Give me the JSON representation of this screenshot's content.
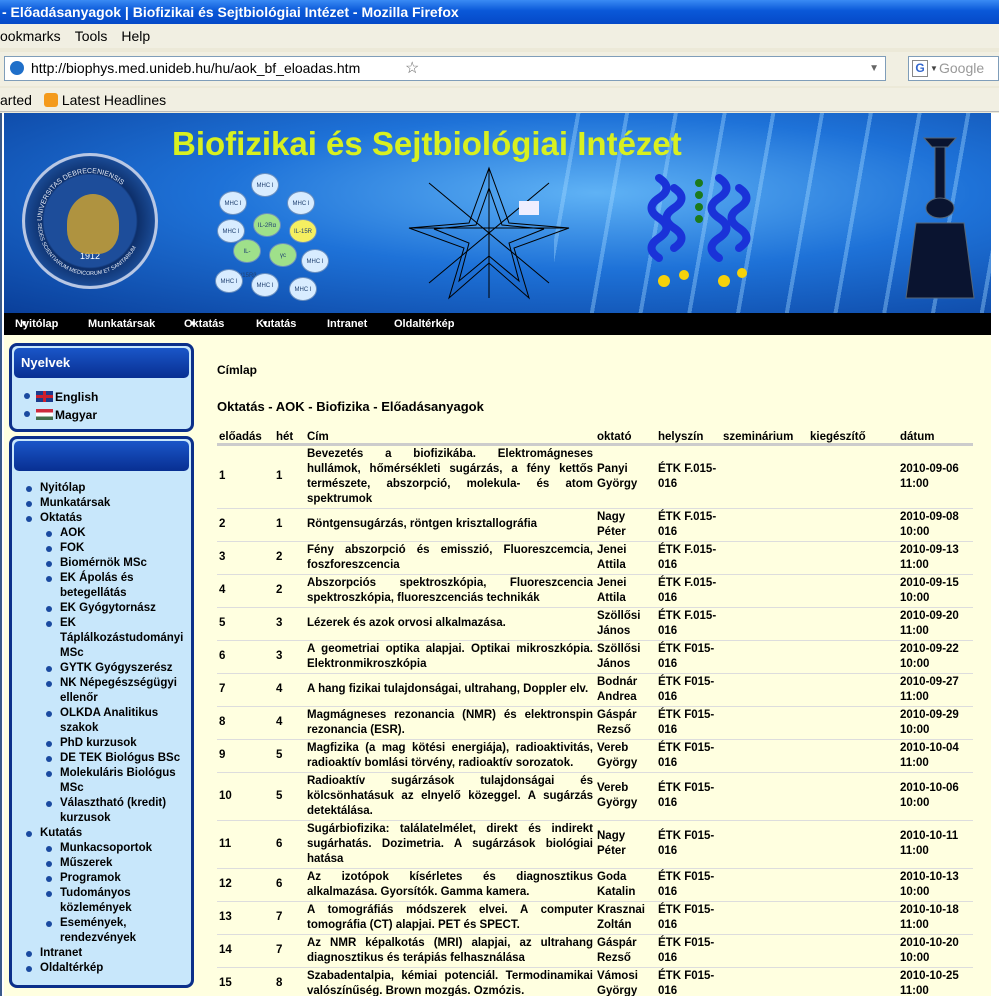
{
  "window": {
    "title": "- Előadásanyagok | Biofizikai és Sejtbiológiai Intézet - Mozilla Firefox"
  },
  "menu": [
    "ookmarks",
    "Tools",
    "Help"
  ],
  "nav": {
    "url": "http://biophys.med.unideb.hu/hu/aok_bf_eloadas.htm",
    "search_placeholder": "Google",
    "search_engine": "G"
  },
  "bookmarks": {
    "first": "arted",
    "feed": "Latest Headlines"
  },
  "banner": {
    "title": "Biofizikai és Sejtbiológiai Intézet",
    "seal_text_top": "UNIVERSITAS DEBRECENIENSIS",
    "seal_text_bottom": "SEDES SCIENTIARUM MEDICORUM ET SANITARIUM",
    "seal_year": "1912",
    "cells": [
      "MHC I",
      "MHC I",
      "MHC I",
      "MHC I",
      "IL-2Rα",
      "IL-15R",
      "MHC I",
      "IL-2/15Rβ",
      "γc",
      "MHC I",
      "MHC I",
      "MHC I"
    ]
  },
  "mainnav": [
    {
      "label": "Nyitólap",
      "caret": true
    },
    {
      "label": "Munkatársak",
      "caret": false
    },
    {
      "label": "Oktatás",
      "caret": true
    },
    {
      "label": "Kutatás",
      "caret": true
    },
    {
      "label": "Intranet",
      "caret": false
    },
    {
      "label": "Oldaltérkép",
      "caret": false
    }
  ],
  "sidebar": {
    "lang_title": "Nyelvek",
    "langs": [
      "English",
      "Magyar"
    ],
    "tree": [
      {
        "l": 1,
        "t": "Nyitólap"
      },
      {
        "l": 1,
        "t": "Munkatársak"
      },
      {
        "l": 1,
        "t": "Oktatás"
      },
      {
        "l": 2,
        "t": "AOK"
      },
      {
        "l": 2,
        "t": "FOK"
      },
      {
        "l": 2,
        "t": "Biomérnök MSc"
      },
      {
        "l": 2,
        "t": "EK Ápolás és betegellátás"
      },
      {
        "l": 2,
        "t": "EK Gyógytornász"
      },
      {
        "l": 2,
        "t": "EK Táplálkozástudományi MSc"
      },
      {
        "l": 2,
        "t": "GYTK Gyógyszerész"
      },
      {
        "l": 2,
        "t": "NK Népegészségügyi ellenőr"
      },
      {
        "l": 2,
        "t": "OLKDA Analitikus szakok"
      },
      {
        "l": 2,
        "t": "PhD kurzusok"
      },
      {
        "l": 2,
        "t": "DE TEK Biológus BSc"
      },
      {
        "l": 2,
        "t": "Molekuláris Biológus MSc"
      },
      {
        "l": 2,
        "t": "Választható (kredit) kurzusok"
      },
      {
        "l": 1,
        "t": "Kutatás"
      },
      {
        "l": 2,
        "t": "Munkacsoportok"
      },
      {
        "l": 2,
        "t": "Műszerek"
      },
      {
        "l": 2,
        "t": "Programok"
      },
      {
        "l": 2,
        "t": "Tudományos közlemények"
      },
      {
        "l": 2,
        "t": "Események, rendezvények"
      },
      {
        "l": 1,
        "t": "Intranet"
      },
      {
        "l": 1,
        "t": "Oldaltérkép"
      }
    ]
  },
  "main": {
    "breadcrumb": "Címlap",
    "title": "Oktatás - AOK - Biofizika - Előadásanyagok",
    "headers": [
      "előadás",
      "hét",
      "Cím",
      "oktató",
      "helyszín",
      "szeminárium",
      "kiegészítő",
      "dátum"
    ],
    "rows": [
      [
        "1",
        "1",
        "Bevezetés a biofizikába. Elektromágneses hullámok, hőmérsékleti sugárzás, a fény kettős természete, abszorpció, molekula- és atom spektrumok",
        "Panyi György",
        "ÉTK F.015-016",
        "",
        "",
        "2010-09-06 11:00"
      ],
      [
        "2",
        "1",
        "Röntgensugárzás, röntgen krisztallográfia",
        "Nagy Péter",
        "ÉTK F.015-016",
        "",
        "",
        "2010-09-08 10:00"
      ],
      [
        "3",
        "2",
        "Fény abszorpció és emisszió, Fluoreszcemcia, foszforeszcencia",
        "Jenei Attila",
        "ÉTK F.015-016",
        "",
        "",
        "2010-09-13 11:00"
      ],
      [
        "4",
        "2",
        "Abszorpciós spektroszkópia, Fluoreszcencia spektroszkópia, fluoreszcenciás technikák",
        "Jenei Attila",
        "ÉTK F.015-016",
        "",
        "",
        "2010-09-15 10:00"
      ],
      [
        "5",
        "3",
        "Lézerek és azok orvosi alkalmazása.",
        "Szöllősi János",
        "ÉTK F.015-016",
        "",
        "",
        "2010-09-20 11:00"
      ],
      [
        "6",
        "3",
        "A geometriai optika alapjai. Optikai mikroszkópia. Elektronmikroszkópia",
        "Szöllősi János",
        "ÉTK F015-016",
        "",
        "",
        "2010-09-22 10:00"
      ],
      [
        "7",
        "4",
        "A hang fizikai tulajdonságai, ultrahang, Doppler elv.",
        "Bodnár Andrea",
        "ÉTK F015-016",
        "",
        "",
        "2010-09-27 11:00"
      ],
      [
        "8",
        "4",
        "Magmágneses rezonancia (NMR) és elektronspin rezonancia (ESR).",
        "Gáspár Rezső",
        "ÉTK F015-016",
        "",
        "",
        "2010-09-29 10:00"
      ],
      [
        "9",
        "5",
        "Magfizika (a mag kötési energiája), radioaktivitás, radioaktív bomlási törvény, radioaktív sorozatok.",
        "Vereb György",
        "ÉTK F015-016",
        "",
        "",
        "2010-10-04 11:00"
      ],
      [
        "10",
        "5",
        "Radioaktív sugárzások tulajdonságai és kölcsönhatásuk az elnyelő közeggel. A sugárzás detektálása.",
        "Vereb György",
        "ÉTK F015-016",
        "",
        "",
        "2010-10-06 10:00"
      ],
      [
        "11",
        "6",
        "Sugárbiofizika: találatelmélet, direkt és indirekt sugárhatás. Dozimetria. A sugárzások biológiai hatása",
        "Nagy Péter",
        "ÉTK F015-016",
        "",
        "",
        "2010-10-11 11:00"
      ],
      [
        "12",
        "6",
        "Az izotópok kísérletes és diagnosztikus alkalmazása. Gyorsítók. Gamma kamera.",
        "Goda Katalin",
        "ÉTK F015-016",
        "",
        "",
        "2010-10-13 10:00"
      ],
      [
        "13",
        "7",
        "A tomográfiás módszerek elvei. A computer tomográfia (CT) alapjai. PET és SPECT.",
        "Krasznai Zoltán",
        "ÉTK F015-016",
        "",
        "",
        "2010-10-18 11:00"
      ],
      [
        "14",
        "7",
        "Az NMR képalkotás (MRI) alapjai, az ultrahang diagnosztikus és terápiás felhasználása",
        "Gáspár Rezső",
        "ÉTK F015-016",
        "",
        "",
        "2010-10-20 10:00"
      ],
      [
        "15",
        "8",
        "Szabadentalpia, kémiai potenciál. Termodinamikai valószínűség. Brown mozgás. Ozmózis.",
        "Vámosi György",
        "ÉTK F015-016",
        "",
        "",
        "2010-10-25 11:00"
      ]
    ]
  }
}
